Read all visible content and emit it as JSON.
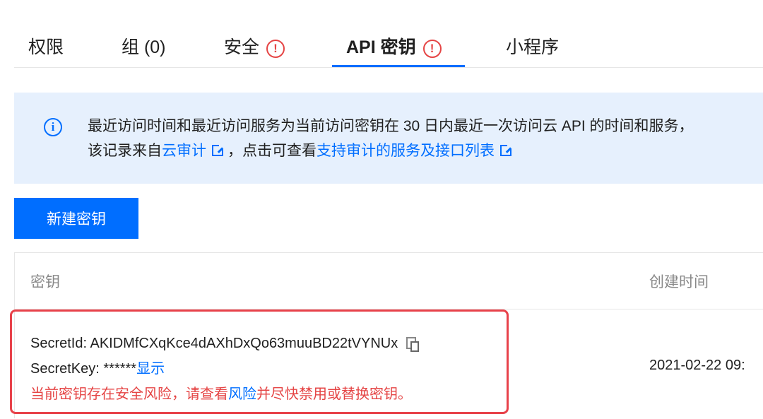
{
  "tabs": [
    {
      "label": "权限",
      "warning": false,
      "active": false
    },
    {
      "label": "组 (0)",
      "warning": false,
      "active": false
    },
    {
      "label": "安全",
      "warning": true,
      "active": false
    },
    {
      "label": "API 密钥",
      "warning": true,
      "active": true
    },
    {
      "label": "小程序",
      "warning": false,
      "active": false
    }
  ],
  "banner": {
    "line1": "最近访问时间和最近访问服务为当前访问密钥在 30 日内最近一次访问云 API 的时间和服务，",
    "line2_prefix": "该记录来自",
    "link1": "云审计",
    "line2_mid": "，点击可查看",
    "link2": "支持审计的服务及接口列表"
  },
  "new_button_label": "新建密钥",
  "table": {
    "col_key": "密钥",
    "col_created": "创建时间",
    "row": {
      "secret_id_label": "SecretId:",
      "secret_id": "AKIDMfCXqKce4dAXhDxQo63muuBD22tVYNUx",
      "secret_key_label": "SecretKey:",
      "secret_key_masked": "******",
      "show_link": "显示",
      "risk_text": "当前密钥存在安全风险，请查看",
      "risk_link": "风险",
      "risk_suffix": "并尽快禁用或替换密钥。",
      "created_time": "2021-02-22 09:"
    }
  },
  "colors": {
    "accent": "#006eff",
    "danger": "#e54545",
    "banner_bg": "#e6f0fd",
    "highlight_border": "#e8424a"
  },
  "icons": [
    "warning-icon",
    "info-icon",
    "external-link-icon",
    "copy-icon"
  ]
}
